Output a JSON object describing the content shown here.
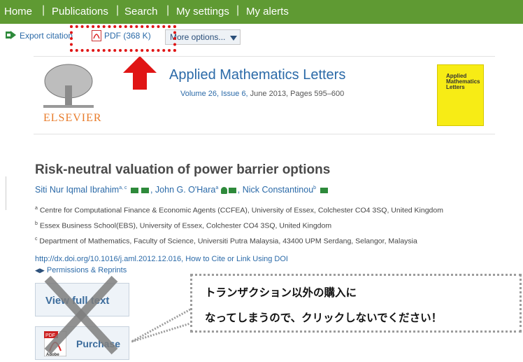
{
  "nav": {
    "items": [
      "Home",
      "Publications",
      "Search",
      "My settings",
      "My alerts"
    ]
  },
  "toolbar": {
    "export": "Export citation",
    "pdf": "PDF (368 K)",
    "more": "More options..."
  },
  "journal": {
    "title": "Applied Mathematics Letters",
    "volume": "Volume 26, Issue 6,",
    "date_pages": " June 2013, Pages 595–600",
    "publisher": "ELSEVIER",
    "cover_title": "Applied Mathematics Letters"
  },
  "article": {
    "title": "Risk-neutral valuation of power barrier options",
    "authors": [
      {
        "name": "Siti Nur Iqmal Ibrahim",
        "sup": "a, c"
      },
      {
        "name": "John G. O'Hara",
        "sup": "a"
      },
      {
        "name": "Nick Constantinou",
        "sup": "b"
      }
    ],
    "affiliations": [
      {
        "sup": "a",
        "text": "Centre for Computational Finance & Economic Agents (CCFEA), University of Essex, Colchester CO4 3SQ, United Kingdom"
      },
      {
        "sup": "b",
        "text": "Essex Business School(EBS), University of Essex, Colchester CO4 3SQ, United Kingdom"
      },
      {
        "sup": "c",
        "text": "Department of Mathematics, Faculty of Science, Universiti Putra Malaysia, 43400 UPM Serdang, Selangor, Malaysia"
      }
    ],
    "doi": "http://dx.doi.org/10.1016/j.aml.2012.12.016, How to Cite or Link Using DOI",
    "permissions": "Permissions & Reprints"
  },
  "buttons": {
    "view_full_text": "View full text",
    "purchase": "Purchase",
    "adobe": "Adobe"
  },
  "callout": {
    "line1": "トランザクション以外の購入に",
    "line2": "なってしまうので、クリックしないでください！"
  },
  "colors": {
    "nav_bg": "#5f9a33",
    "link": "#2b6aa8",
    "highlight": "#e01515"
  }
}
